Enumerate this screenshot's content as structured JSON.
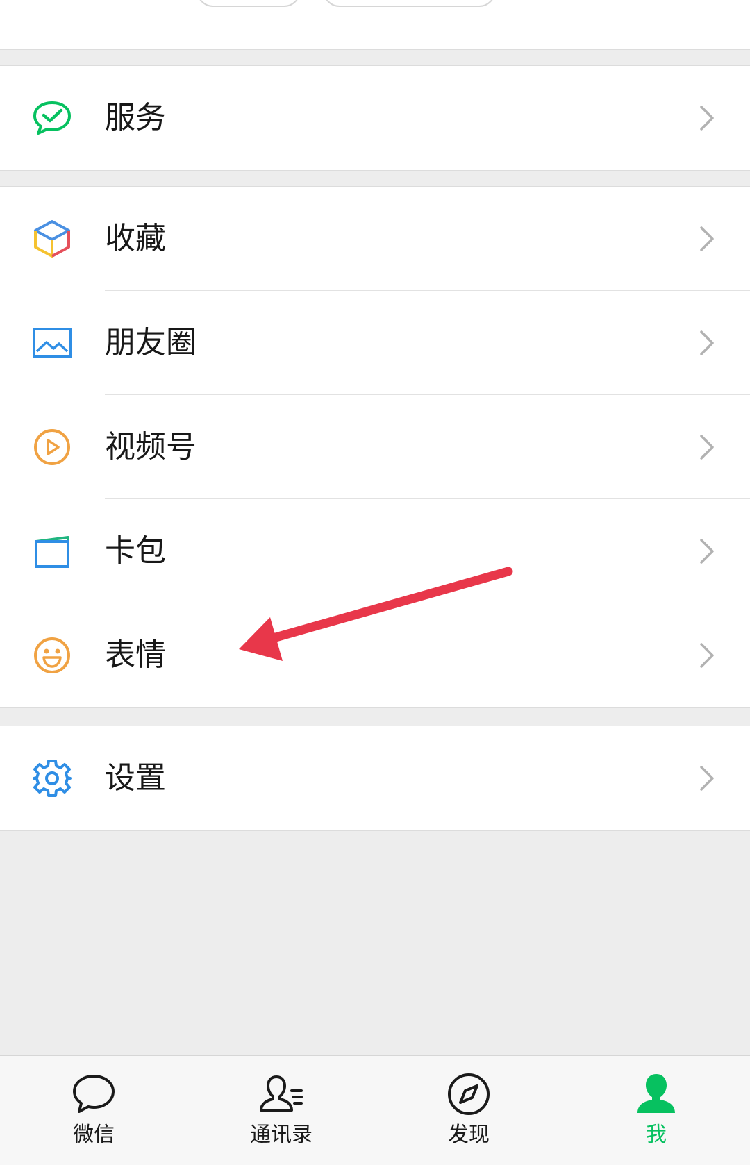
{
  "menu": {
    "service": {
      "label": "服务",
      "icon": "service-check-bubble-icon"
    },
    "favorites": {
      "label": "收藏",
      "icon": "favorites-cube-icon"
    },
    "moments": {
      "label": "朋友圈",
      "icon": "moments-picture-icon"
    },
    "channels": {
      "label": "视频号",
      "icon": "channels-play-icon"
    },
    "card_wallet": {
      "label": "卡包",
      "icon": "card-wallet-icon"
    },
    "stickers": {
      "label": "表情",
      "icon": "smiley-face-icon"
    },
    "settings": {
      "label": "设置",
      "icon": "gear-icon"
    }
  },
  "tabbar": {
    "chats": {
      "label": "微信",
      "icon": "chat-bubble-icon"
    },
    "contacts": {
      "label": "通讯录",
      "icon": "contacts-icon"
    },
    "discover": {
      "label": "发现",
      "icon": "compass-icon"
    },
    "me": {
      "label": "我",
      "icon": "person-icon",
      "active": true
    }
  },
  "colors": {
    "brand_green": "#07c160",
    "annotation_red": "#e8374a",
    "background": "#ededed"
  }
}
